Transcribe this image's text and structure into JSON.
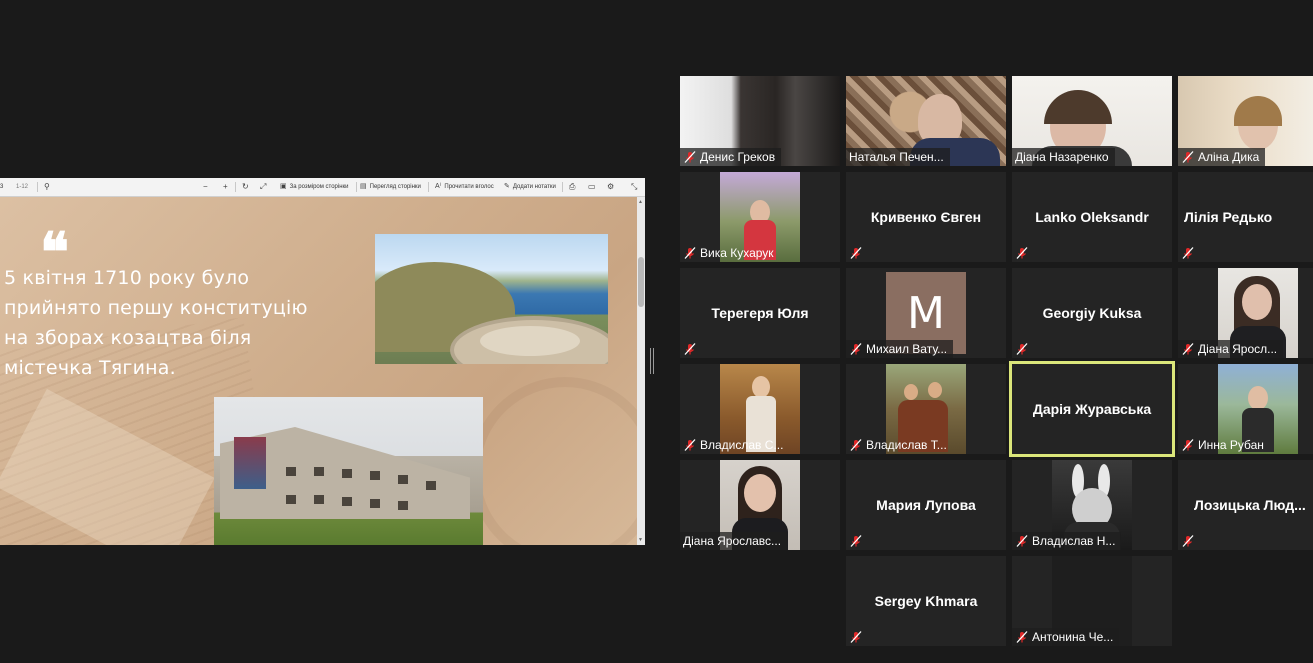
{
  "pdf_toolbar": {
    "page_num": "3",
    "page_total": "1-12",
    "fit_label": "За розміром сторінки",
    "view_label": "Перегляд сторінки",
    "read_label": "Прочитати вголос",
    "notes_label": "Додати нотатки"
  },
  "slide": {
    "quote_mark": "❝",
    "text": "5 квітня 1710 року було прийнято першу конституцію на зборах козацтва біля містечка Тягина."
  },
  "participants": [
    {
      "name": "Денис Греков",
      "muted": true
    },
    {
      "name": "Наталья Печен...",
      "muted": false
    },
    {
      "name": "Діана Назаренко",
      "muted": false
    },
    {
      "name": "Аліна Дика",
      "muted": true
    },
    {
      "name": "Вика Кухарук",
      "muted": true
    },
    {
      "name": "Кривенко Євген",
      "muted": true
    },
    {
      "name": "Lanko Oleksandr",
      "muted": true
    },
    {
      "name": "Лілія Редько",
      "muted": true
    },
    {
      "name": "Терегеря Юля",
      "muted": true
    },
    {
      "name": "Михаил Вату...",
      "muted": true,
      "avatar_letter": "M"
    },
    {
      "name": "Georgiy Kuksa",
      "muted": true
    },
    {
      "name": "Діана Яросл...",
      "muted": true
    },
    {
      "name": "Владислав С...",
      "muted": true
    },
    {
      "name": "Владислав Т...",
      "muted": true
    },
    {
      "name": "Дарія Журавська",
      "muted": false,
      "active_speaker": true
    },
    {
      "name": "Инна Рубан",
      "muted": true
    },
    {
      "name": "Діана Ярославс...",
      "muted": false
    },
    {
      "name": "Мария Лупова",
      "muted": true
    },
    {
      "name": "Владислав Н...",
      "muted": true
    },
    {
      "name": "Лозицька Люд...",
      "muted": true
    },
    {
      "name": "Sergey Khmara",
      "muted": true
    },
    {
      "name": "Антонина Че...",
      "muted": true
    }
  ],
  "colors": {
    "active_speaker_border": "#dbe67a",
    "muted_icon": "#e02828",
    "tile_bg": "#242424"
  }
}
